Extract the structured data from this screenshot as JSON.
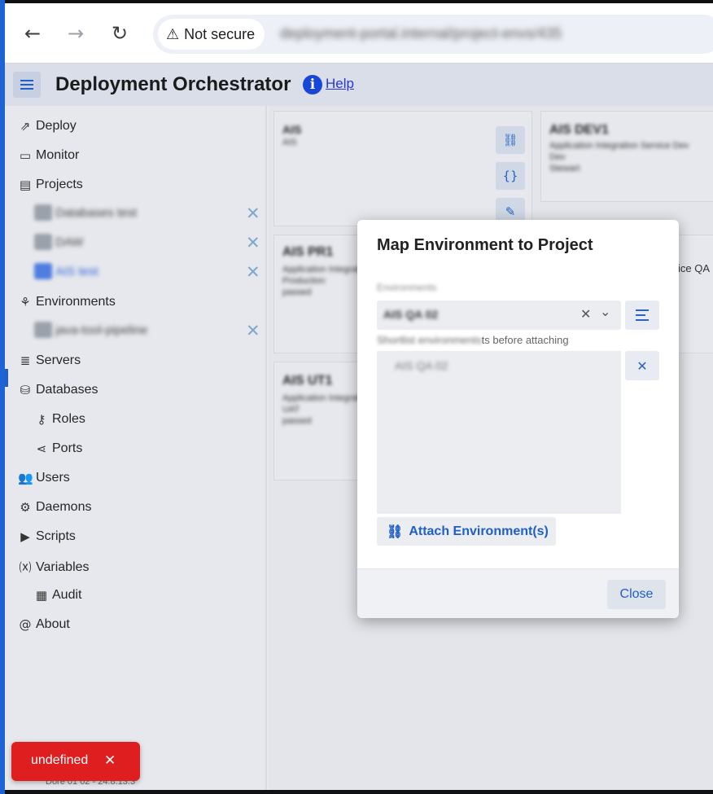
{
  "browser": {
    "back_icon": "←",
    "forward_icon": "→",
    "reload_icon": "↻",
    "security_icon": "⚠",
    "security_label": "Not secure",
    "url": "deployment-portal.internal/project-envs/435"
  },
  "header": {
    "title": "Deployment Orchestrator",
    "help_icon": "i",
    "help_label": "Help"
  },
  "sidebar": {
    "items": {
      "deploy": "Deploy",
      "monitor": "Monitor",
      "projects": "Projects",
      "environments": "Environments",
      "servers": "Servers",
      "databases": "Databases",
      "roles": "Roles",
      "ports": "Ports",
      "users": "Users",
      "daemons": "Daemons",
      "scripts": "Scripts",
      "variables": "Variables",
      "audit": "Audit",
      "about": "About"
    },
    "projects": [
      "Databases test",
      "DAW",
      "AIS test"
    ],
    "environments": [
      "java-tool-pipeline"
    ],
    "remove_icon": "✕",
    "version": "Dore 01 02 - 24.8.13.3"
  },
  "cards": [
    {
      "title": "AIS",
      "subtitle": "AIS"
    },
    {
      "title": "AIS DEV1",
      "lines": [
        "Application Integration Service Dev",
        "Dev",
        "Stewart"
      ]
    },
    {
      "title": "AIS PR1",
      "lines": [
        "Application Integration",
        "Production",
        "passed"
      ]
    },
    {
      "title": "AIS UT1",
      "lines": [
        "Application Integration",
        "UAT",
        "passed"
      ]
    }
  ],
  "card_partial_text": "ice QA",
  "dialog": {
    "title": "Map Environment to Project",
    "field_label": "Environments",
    "selected_value": "AIS QA 02",
    "clear_icon": "✕",
    "caret_icon": "⌄",
    "hint_blurred": "Shortlist environments",
    "hint_visible": "ts before attaching",
    "list_entries": [
      "AIS QA 02"
    ],
    "remove_icon": "✕",
    "attach_icon": "🔗",
    "attach_label": "Attach Environment(s)",
    "close_label": "Close"
  },
  "toast": {
    "message": "undefined",
    "close_icon": "✕",
    "color": "#df1f1f"
  },
  "colors": {
    "accent": "#1f5fc7",
    "help": "#1747d8"
  }
}
